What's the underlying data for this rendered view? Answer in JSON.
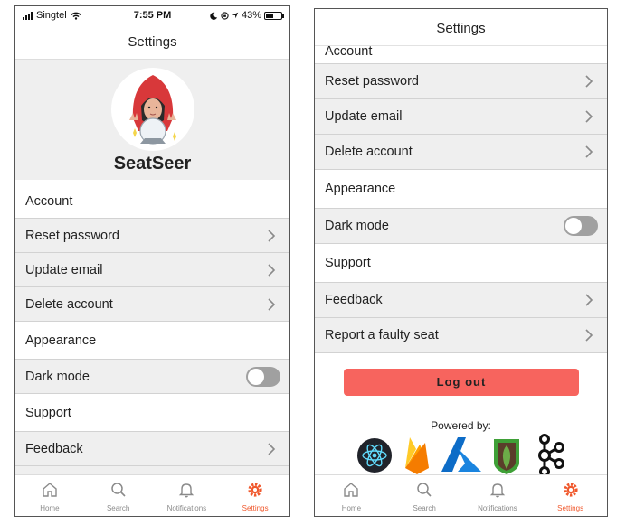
{
  "status_bar": {
    "carrier": "Singtel",
    "time": "7:55 PM",
    "battery": "43%",
    "battery_level": 0.43
  },
  "screen_title": "Settings",
  "brand_name": "SeatSeer",
  "sections": {
    "account": "Account",
    "reset_password": "Reset password",
    "update_email": "Update email",
    "delete_account": "Delete account",
    "appearance": "Appearance",
    "dark_mode": "Dark mode",
    "dark_mode_enabled": false,
    "support": "Support",
    "feedback": "Feedback",
    "report_faulty_seat": "Report a faulty seat"
  },
  "logout_label": "Log out",
  "powered_by": "Powered by:",
  "tech_logos": [
    "react-logo",
    "firebase-logo",
    "azure-logo",
    "mongodb-logo",
    "kafka-logo"
  ],
  "tabs": [
    {
      "label": "Home",
      "icon": "home-icon",
      "active": false
    },
    {
      "label": "Search",
      "icon": "search-icon",
      "active": false
    },
    {
      "label": "Notifications",
      "icon": "bell-icon",
      "active": false
    },
    {
      "label": "Settings",
      "icon": "gear-icon",
      "active": true
    }
  ],
  "colors": {
    "accent": "#f0582c",
    "logout": "#f7645e",
    "row_bg": "#efefef",
    "toggle_off": "#a0a0a0"
  }
}
